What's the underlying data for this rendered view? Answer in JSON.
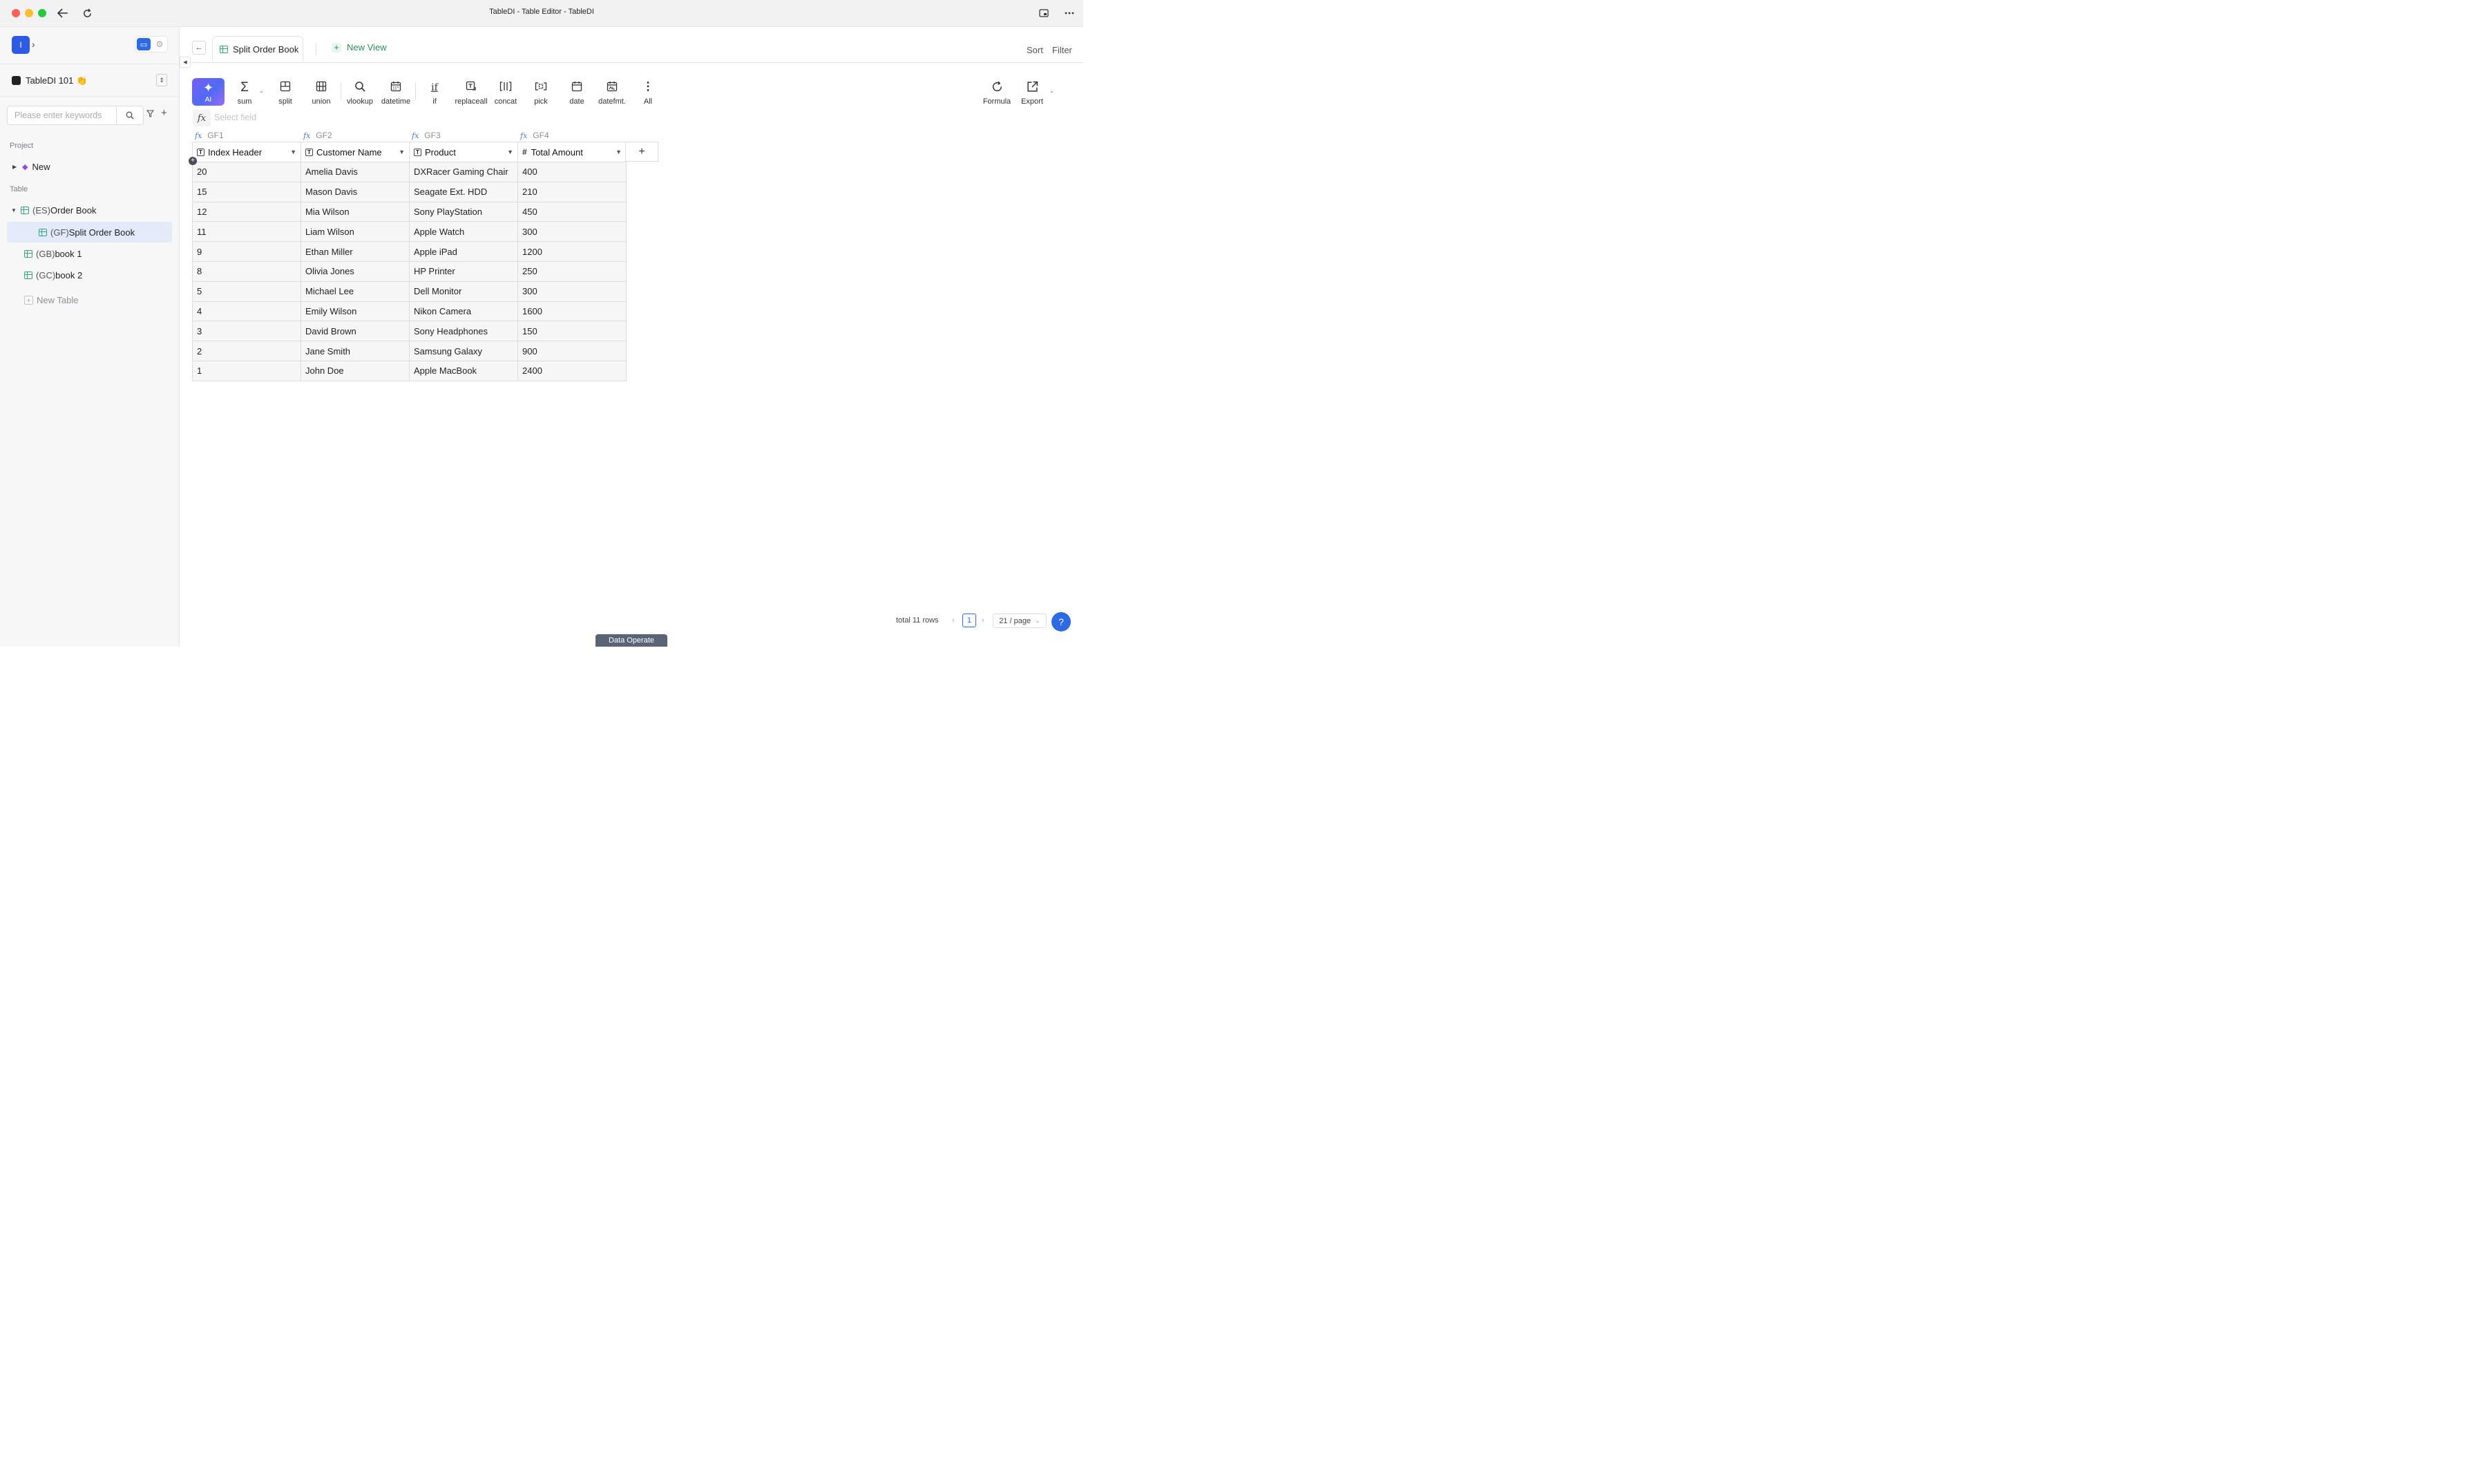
{
  "window": {
    "title": "TableDI - Table Editor - TableDI"
  },
  "sidebar": {
    "logo_letter": "I",
    "project_name": "TableDI 101 👏",
    "search_placeholder": "Please enter keywords",
    "section_project": "Project",
    "section_table": "Table",
    "project_items": [
      {
        "label": "New"
      }
    ],
    "tables": [
      {
        "prefix": "(ES)",
        "name": "Order Book"
      },
      {
        "prefix": "(GF)",
        "name": "Split Order Book"
      },
      {
        "prefix": "(GB)",
        "name": "book 1"
      },
      {
        "prefix": "(GC)",
        "name": "book 2"
      }
    ],
    "new_table_label": "New Table"
  },
  "tabs": {
    "active_label": "Split Order Book",
    "new_view_label": "New View",
    "sort_label": "Sort",
    "filter_label": "Filter"
  },
  "toolbar": {
    "ai_label": "AI",
    "tools": [
      {
        "label": "sum",
        "icon": "sigma-icon"
      },
      {
        "label": "split",
        "icon": "split-icon"
      },
      {
        "label": "union",
        "icon": "union-icon"
      },
      {
        "label": "vlookup",
        "icon": "search-icon"
      },
      {
        "label": "datetime",
        "icon": "calendar-icon"
      },
      {
        "label": "if",
        "icon": "if-icon"
      },
      {
        "label": "replaceall",
        "icon": "replace-icon"
      },
      {
        "label": "concat",
        "icon": "concat-icon"
      },
      {
        "label": "pick",
        "icon": "pick-icon"
      },
      {
        "label": "date",
        "icon": "calendar-icon"
      },
      {
        "label": "datefmt.",
        "icon": "calendar-format-icon"
      },
      {
        "label": "All",
        "icon": "more-vertical-icon"
      }
    ],
    "formula_label": "Formula",
    "export_label": "Export"
  },
  "formula_bar": {
    "placeholder": "Select field"
  },
  "grid": {
    "field_ids": [
      "GF1",
      "GF2",
      "GF3",
      "GF4"
    ],
    "columns": [
      {
        "label": "Index Header",
        "type": "text"
      },
      {
        "label": "Customer Name",
        "type": "text"
      },
      {
        "label": "Product",
        "type": "text"
      },
      {
        "label": "Total Amount",
        "type": "number"
      }
    ],
    "rows": [
      [
        "20",
        "Amelia Davis",
        "DXRacer Gaming Chair",
        "400"
      ],
      [
        "15",
        "Mason Davis",
        "Seagate Ext. HDD",
        "210"
      ],
      [
        "12",
        "Mia Wilson",
        "Sony PlayStation",
        "450"
      ],
      [
        "11",
        "Liam Wilson",
        "Apple Watch",
        "300"
      ],
      [
        "9",
        "Ethan Miller",
        "Apple iPad",
        "1200"
      ],
      [
        "8",
        "Olivia Jones",
        "HP Printer",
        "250"
      ],
      [
        "5",
        "Michael Lee",
        "Dell Monitor",
        "300"
      ],
      [
        "4",
        "Emily Wilson",
        "Nikon Camera",
        "1600"
      ],
      [
        "3",
        "David Brown",
        "Sony Headphones",
        "150"
      ],
      [
        "2",
        "Jane Smith",
        "Samsung Galaxy",
        "900"
      ],
      [
        "1",
        "John Doe",
        "Apple MacBook",
        "2400"
      ]
    ]
  },
  "footer": {
    "total_rows": "total 11 rows",
    "current_page": "1",
    "page_size": "21 / page",
    "data_operate_label": "Data Operate"
  }
}
